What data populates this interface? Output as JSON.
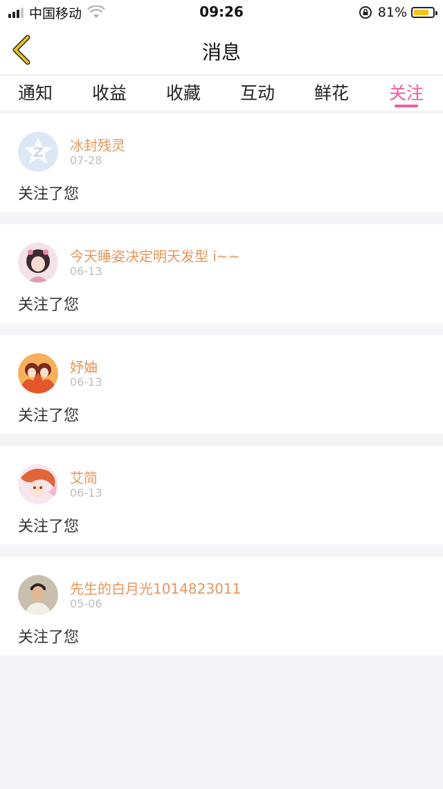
{
  "status_bar": {
    "carrier": "中国移动",
    "time": "09:26",
    "battery_percent": "81%",
    "battery_level": 0.81,
    "battery_color": "#f6c51c"
  },
  "header": {
    "title": "消息",
    "back_icon": "chevron-left-icon",
    "back_color": "#e8c21e"
  },
  "tabs": {
    "items": [
      "通知",
      "收益",
      "收藏",
      "互动",
      "鲜花",
      "关注"
    ],
    "active_index": 5,
    "active_color": "#ef5c9c"
  },
  "messages": [
    {
      "name": "冰封残灵",
      "date": "07-28",
      "text": "关注了您"
    },
    {
      "name": "今天睡姿决定明天发型 i~~",
      "date": "06-13",
      "text": "关注了您"
    },
    {
      "name": "妤妯",
      "date": "06-13",
      "text": "关注了您"
    },
    {
      "name": "艾简",
      "date": "06-13",
      "text": "关注了您"
    },
    {
      "name": "先生的白月光1014823011",
      "date": "05-06",
      "text": "关注了您"
    }
  ],
  "colors": {
    "name": "#e8955a",
    "background": "#f5f4f8"
  }
}
